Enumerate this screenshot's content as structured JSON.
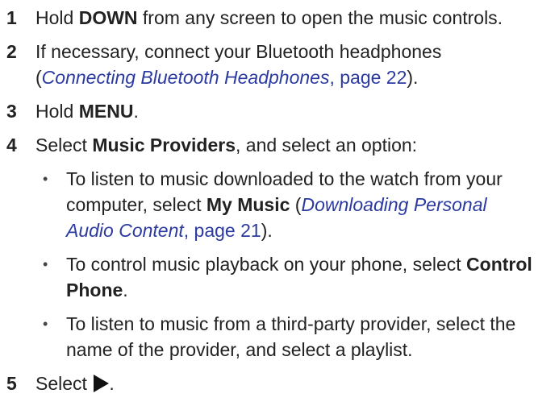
{
  "steps": [
    {
      "num": "1",
      "pre": "Hold ",
      "bold": "DOWN",
      "post": " from any screen to open the music controls."
    },
    {
      "num": "2",
      "pre": "If necessary, connect your Bluetooth headphones (",
      "link_title": "Connecting Bluetooth Headphones",
      "link_page": ", page 22",
      "post": ")."
    },
    {
      "num": "3",
      "pre": "Hold ",
      "bold": "MENU",
      "post": "."
    },
    {
      "num": "4",
      "pre": "Select ",
      "bold": "Music Providers",
      "post": ", and select an option:",
      "bullets": [
        {
          "pre": "To listen to music downloaded to the watch from your computer, select ",
          "bold": "My Music",
          "mid": " (",
          "link_title": "Downloading Personal Audio Content",
          "link_page": ", page 21",
          "post": ")."
        },
        {
          "pre": "To control music playback on your phone, select ",
          "bold": "Control Phone",
          "post": "."
        },
        {
          "pre": "To listen to music from a third-party provider, select the name of the provider, and select a playlist."
        }
      ]
    },
    {
      "num": "5",
      "pre": "Select ",
      "icon": "play-icon",
      "post": "."
    }
  ],
  "bullet_char": "•",
  "colors": {
    "text": "#222222",
    "link": "#2b3aa0"
  }
}
